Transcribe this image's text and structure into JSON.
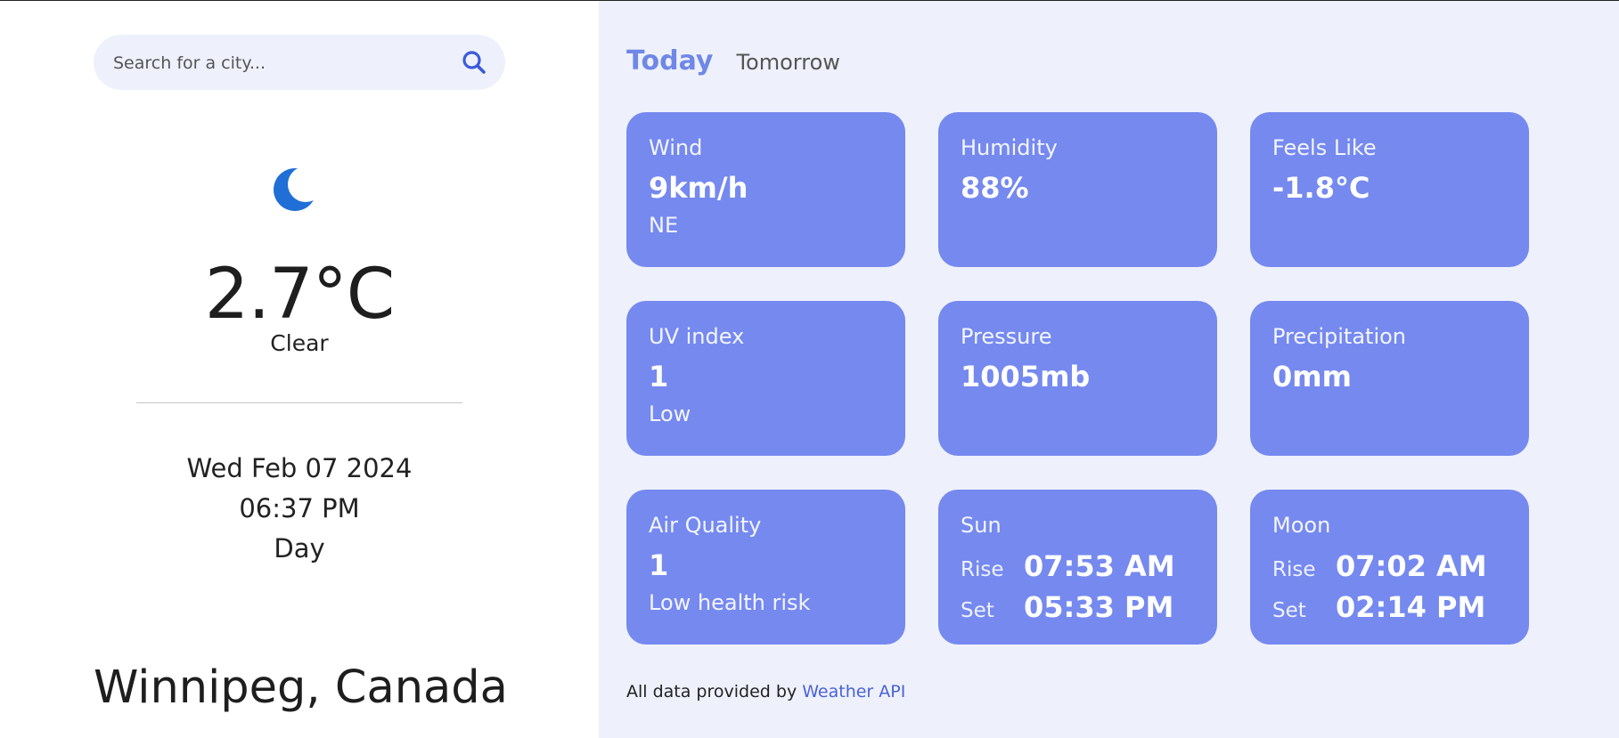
{
  "search": {
    "placeholder": "Search for a city..."
  },
  "current": {
    "icon": "moon-icon",
    "temperature": "2.7°C",
    "condition": "Clear",
    "date": "Wed Feb 07 2024",
    "time": "06:37 PM",
    "daypart": "Day",
    "location": "Winnipeg, Canada"
  },
  "tabs": [
    {
      "label": "Today",
      "active": true
    },
    {
      "label": "Tomorrow",
      "active": false
    }
  ],
  "cards": {
    "wind": {
      "title": "Wind",
      "value": "9km/h",
      "sub": "NE"
    },
    "humidity": {
      "title": "Humidity",
      "value": "88%"
    },
    "feels_like": {
      "title": "Feels Like",
      "value": "-1.8°C"
    },
    "uv": {
      "title": "UV index",
      "value": "1",
      "sub": "Low"
    },
    "pressure": {
      "title": "Pressure",
      "value": "1005mb"
    },
    "precipitation": {
      "title": "Precipitation",
      "value": "0mm"
    },
    "air_quality": {
      "title": "Air Quality",
      "value": "1",
      "sub": "Low health risk"
    },
    "sun": {
      "title": "Sun",
      "rise_label": "Rise",
      "rise": "07:53 AM",
      "set_label": "Set",
      "set": "05:33 PM"
    },
    "moon": {
      "title": "Moon",
      "rise_label": "Rise",
      "rise": "07:02 AM",
      "set_label": "Set",
      "set": "02:14 PM"
    }
  },
  "footer": {
    "text": "All data provided by",
    "link": "Weather API"
  },
  "colors": {
    "accent": "#6f87e6",
    "card": "#7589ef",
    "panel": "#eef1fc",
    "link": "#4a62d8",
    "moon_icon": "#1f6fd6"
  }
}
